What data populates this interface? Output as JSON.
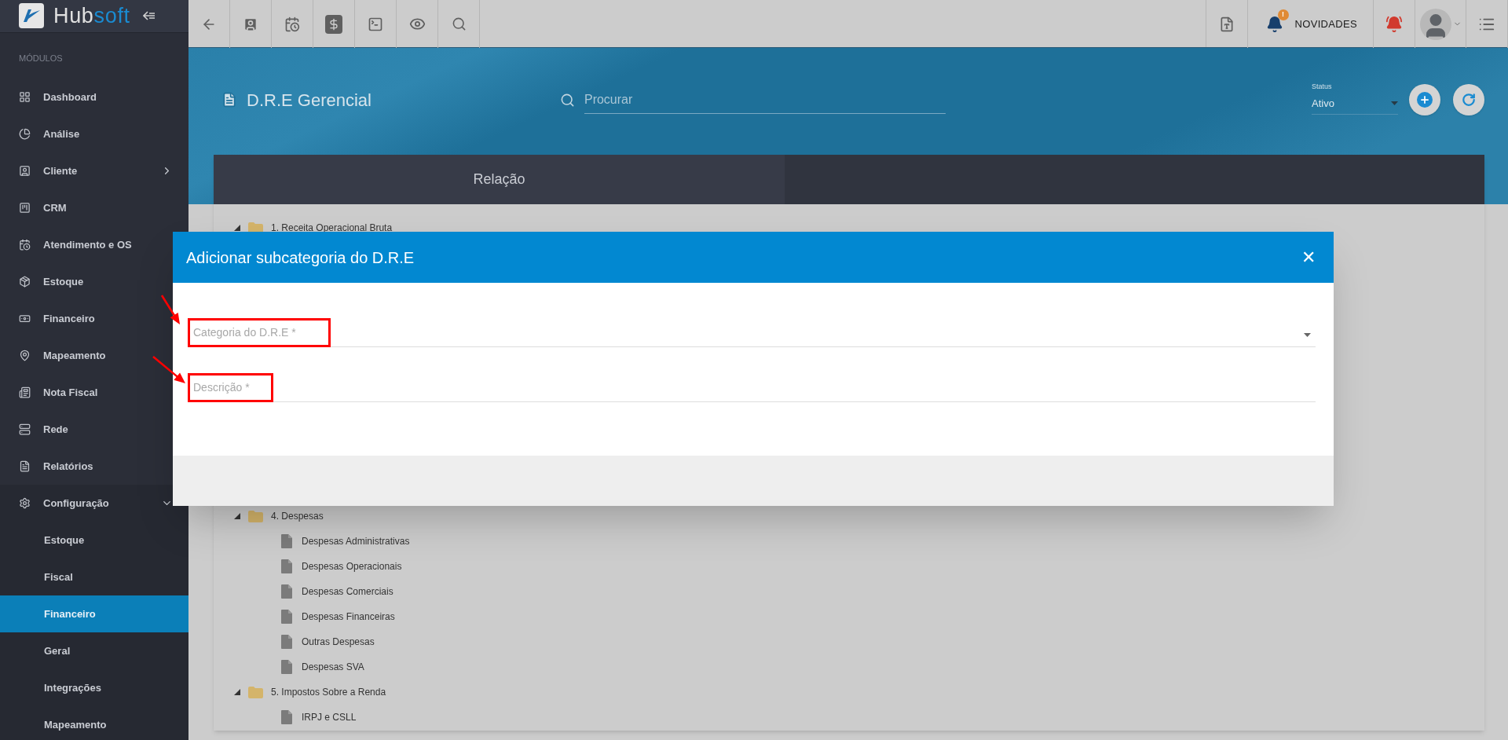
{
  "logo": {
    "text_main": "Hub",
    "text_accent": "soft"
  },
  "topbar": {
    "news": {
      "label": "NOVIDADES",
      "badge": "!"
    }
  },
  "sidebar": {
    "heading": "MÓDULOS",
    "items": [
      {
        "label": "Dashboard"
      },
      {
        "label": "Análise"
      },
      {
        "label": "Cliente",
        "expanded": false
      },
      {
        "label": "CRM"
      },
      {
        "label": "Atendimento e OS"
      },
      {
        "label": "Estoque"
      },
      {
        "label": "Financeiro"
      },
      {
        "label": "Mapeamento"
      },
      {
        "label": "Nota Fiscal"
      },
      {
        "label": "Rede"
      },
      {
        "label": "Relatórios"
      },
      {
        "label": "Configuração",
        "expanded": true,
        "children": [
          {
            "label": "Estoque",
            "selected": false
          },
          {
            "label": "Fiscal",
            "selected": false
          },
          {
            "label": "Financeiro",
            "selected": true
          },
          {
            "label": "Geral",
            "selected": false
          },
          {
            "label": "Integrações",
            "selected": false
          },
          {
            "label": "Mapeamento",
            "selected": false
          }
        ]
      }
    ]
  },
  "page": {
    "title": "D.R.E Gerencial",
    "search": {
      "placeholder": "Procurar"
    },
    "status": {
      "label": "Status",
      "value": "Ativo"
    }
  },
  "tabs": [
    {
      "label": "Relação",
      "selected": true
    }
  ],
  "tree": [
    {
      "label": "1. Receita Operacional Bruta",
      "expanded": true
    },
    {
      "label": "4. Despesas",
      "expanded": true,
      "children": [
        {
          "label": "Despesas Administrativas"
        },
        {
          "label": "Despesas Operacionais"
        },
        {
          "label": "Despesas Comerciais"
        },
        {
          "label": "Despesas Financeiras"
        },
        {
          "label": "Outras Despesas"
        },
        {
          "label": "Despesas SVA"
        }
      ]
    },
    {
      "label": "5. Impostos Sobre a Renda",
      "expanded": true,
      "children": [
        {
          "label": "IRPJ e CSLL"
        }
      ]
    }
  ],
  "modal": {
    "title": "Adicionar subcategoria do D.R.E",
    "close": "✕",
    "fields": [
      {
        "kind": "select",
        "placeholder": "Categoria do D.R.E *",
        "highlighted": true
      },
      {
        "kind": "text",
        "placeholder": "Descrição *",
        "highlighted": true
      }
    ]
  }
}
